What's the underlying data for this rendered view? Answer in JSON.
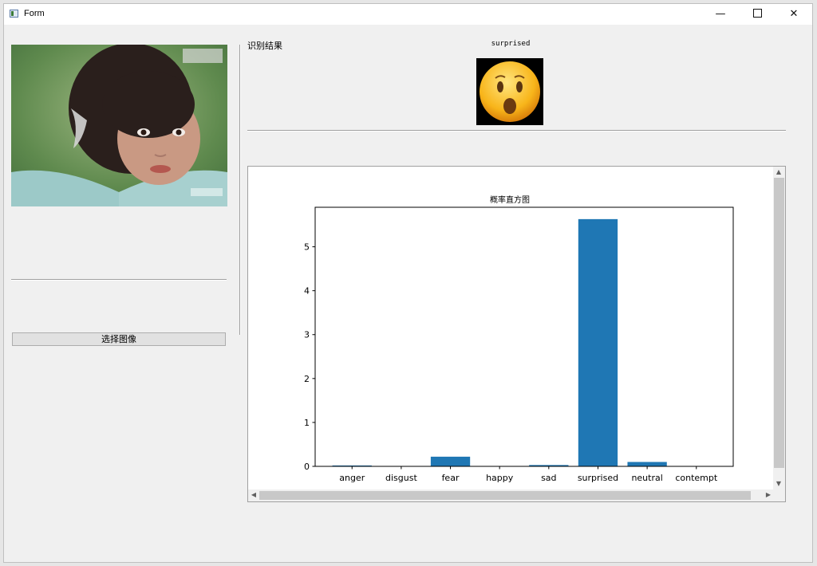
{
  "window": {
    "title": "Form",
    "controls": {
      "minimize": "—",
      "maximize": "",
      "close": "✕"
    }
  },
  "left_panel": {
    "select_button_label": "选择图像"
  },
  "result": {
    "label": "识别结果",
    "emotion": "surprised"
  },
  "chart_data": {
    "type": "bar",
    "title": "概率直方图",
    "categories": [
      "anger",
      "disgust",
      "fear",
      "happy",
      "sad",
      "surprised",
      "neutral",
      "contempt"
    ],
    "values": [
      0.02,
      0.0,
      0.22,
      0.0,
      0.03,
      5.63,
      0.1,
      0.0
    ],
    "ylim": [
      0,
      5.9
    ],
    "yticks": [
      "0",
      "1",
      "2",
      "3",
      "4",
      "5"
    ],
    "xlabel": "",
    "ylabel": "",
    "bar_color": "#1f77b4"
  },
  "scroll_arrows": {
    "up": "▲",
    "down": "▼",
    "left": "◀",
    "right": "▶"
  }
}
